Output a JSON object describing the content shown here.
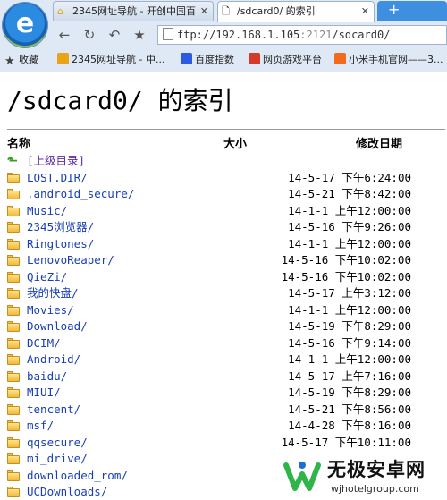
{
  "browser": {
    "tabs": [
      {
        "title": "2345网址导航 - 开创中国百",
        "close": "✕",
        "active": false
      },
      {
        "title": "/sdcard0/ 的索引",
        "close": "✕",
        "active": true
      }
    ],
    "new_tab": "+",
    "url": "ftp://192.168.1.105",
    "url_port": ":2121",
    "url_path": "/sdcard0/",
    "bookmarks": [
      {
        "label": "收藏",
        "icon": "star-icon",
        "color": "#444444"
      },
      {
        "label": "2345网址导航 - 中...",
        "icon": "site-icon",
        "color": "#e8a318"
      },
      {
        "label": "百度指数",
        "icon": "baidu-icon",
        "color": "#2d5be0"
      },
      {
        "label": "网页游戏平台",
        "icon": "game-icon",
        "color": "#d33a2c"
      },
      {
        "label": "小米手机官网——3...",
        "icon": "mi-icon",
        "color": "#f26b1d"
      }
    ]
  },
  "page": {
    "title": "/sdcard0/ 的索引",
    "columns": {
      "name": "名称",
      "size": "大小",
      "modified": "修改日期"
    },
    "parent_link": "[上级目录]",
    "entries": [
      {
        "name": "LOST.DIR/",
        "date": "14-5-17 下午6:24:00"
      },
      {
        "name": ".android_secure/",
        "date": "14-5-21 下午8:42:00"
      },
      {
        "name": "Music/",
        "date": "14-1-1 上午12:00:00"
      },
      {
        "name": "2345浏览器/",
        "date": "14-5-16 下午9:26:00"
      },
      {
        "name": "Ringtones/",
        "date": "14-1-1 上午12:00:00"
      },
      {
        "name": "LenovoReaper/",
        "date": "14-5-16 下午10:02:00"
      },
      {
        "name": "QieZi/",
        "date": "14-5-16 下午10:02:00"
      },
      {
        "name": "我的快盘/",
        "date": "14-5-17 上午3:12:00"
      },
      {
        "name": "Movies/",
        "date": "14-1-1 上午12:00:00"
      },
      {
        "name": "Download/",
        "date": "14-5-19 下午8:29:00"
      },
      {
        "name": "DCIM/",
        "date": "14-5-16 下午9:14:00"
      },
      {
        "name": "Android/",
        "date": "14-1-1 上午12:00:00"
      },
      {
        "name": "baidu/",
        "date": "14-5-17 上午7:16:00"
      },
      {
        "name": "MIUI/",
        "date": "14-5-19 下午8:29:00"
      },
      {
        "name": "tencent/",
        "date": "14-5-21 下午8:56:00"
      },
      {
        "name": "msf/",
        "date": "14-4-28 下午8:16:00"
      },
      {
        "name": "qqsecure/",
        "date": "14-5-17 下午10:11:00"
      },
      {
        "name": "mi_drive/",
        "date": ""
      },
      {
        "name": "downloaded_rom/",
        "date": ""
      },
      {
        "name": "UCDownloads/",
        "date": ""
      }
    ]
  },
  "watermark": {
    "title": "无极安卓网",
    "url": "wjhotelgroup.com",
    "colors": {
      "green": "#2fb44a",
      "blue": "#1e6fd0"
    }
  }
}
